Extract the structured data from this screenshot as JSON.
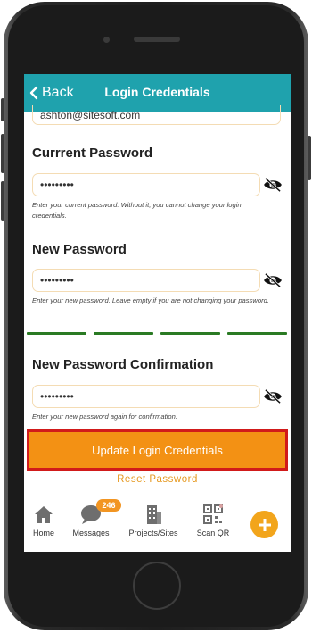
{
  "header": {
    "back_label": "Back",
    "title": "Login Credentials"
  },
  "form": {
    "email_value": "ashton@sitesoft.com",
    "current": {
      "label": "Currrent Password",
      "value": "•••••••••",
      "help": "Enter your current password. Without it, you cannot change your login credentials."
    },
    "new": {
      "label": "New Password",
      "value": "•••••••••",
      "help": "Enter your new password. Leave empty if you are not changing your password."
    },
    "confirm": {
      "label": "New Password Confirmation",
      "value": "•••••••••",
      "help": "Enter your new password again for confirmation."
    },
    "strength_segments": 4,
    "strength_color": "#2a7a23"
  },
  "actions": {
    "update_label": "Update Login Credentials",
    "reset_label": "Reset Password"
  },
  "tabs": [
    {
      "label": "Home",
      "icon": "home-icon"
    },
    {
      "label": "Messages",
      "icon": "chat-icon",
      "badge": "246"
    },
    {
      "label": "Projects/Sites",
      "icon": "building-icon"
    },
    {
      "label": "Scan QR",
      "icon": "qr-icon"
    }
  ],
  "colors": {
    "header": "#1fa2ad",
    "accent": "#f39114",
    "highlight": "#d11a1a"
  }
}
